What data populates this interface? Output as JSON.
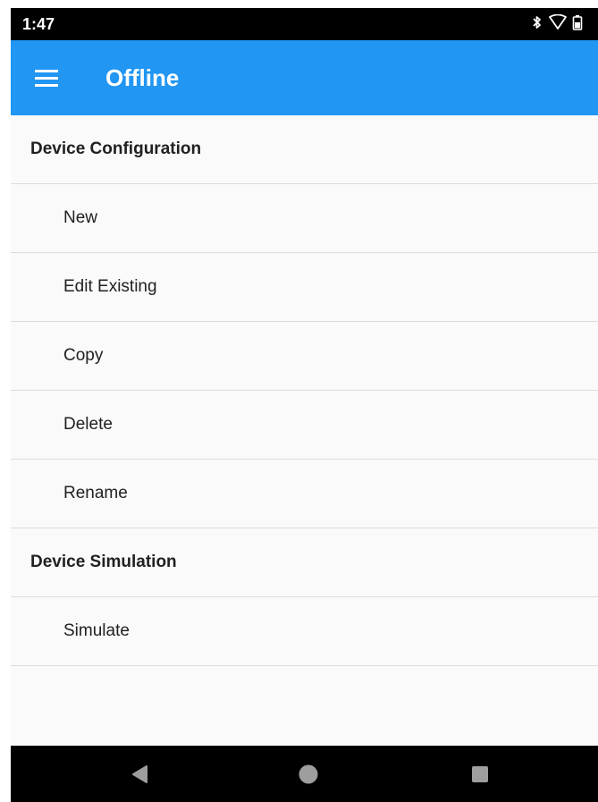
{
  "status_bar": {
    "time": "1:47",
    "icons": [
      "bluetooth-icon",
      "wifi-icon",
      "battery-icon"
    ]
  },
  "app_bar": {
    "title": "Offline",
    "color": "#2196f3",
    "menu_icon": "hamburger-menu-icon"
  },
  "list": {
    "sections": [
      {
        "header": "Device Configuration",
        "items": [
          "New",
          "Edit Existing",
          "Copy",
          "Delete",
          "Rename"
        ]
      },
      {
        "header": "Device Simulation",
        "items": [
          "Simulate"
        ]
      }
    ]
  },
  "nav_bar": {
    "buttons": [
      "back-icon",
      "home-icon",
      "recents-icon"
    ],
    "icon_color": "#9e9e9e"
  }
}
